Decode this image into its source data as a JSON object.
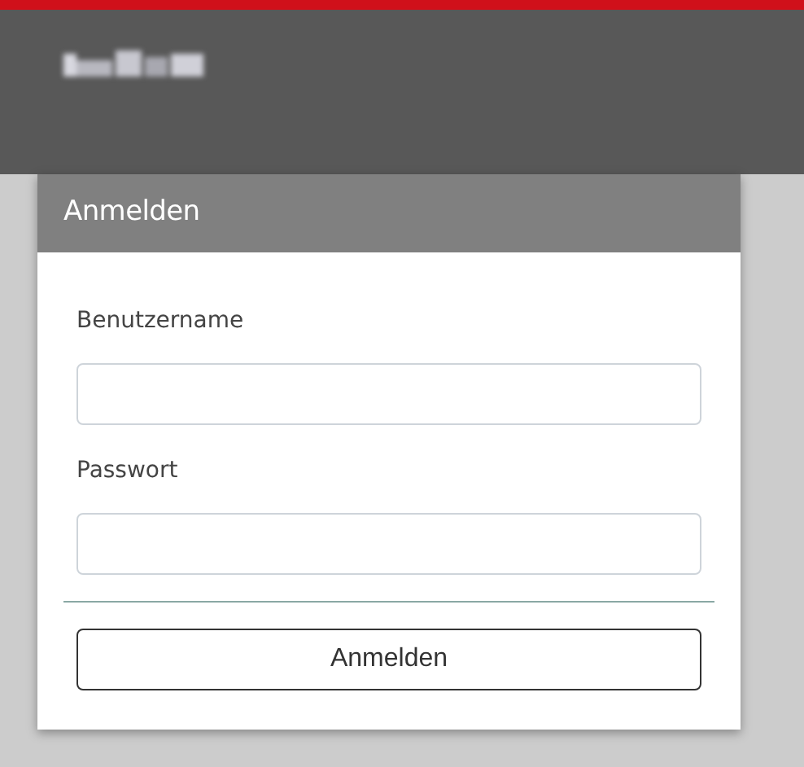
{
  "card": {
    "title": "Anmelden"
  },
  "fields": [
    {
      "label": "Benutzername"
    },
    {
      "label": "Passwort"
    }
  ],
  "submit_button": {
    "label": "Anmelden"
  }
}
